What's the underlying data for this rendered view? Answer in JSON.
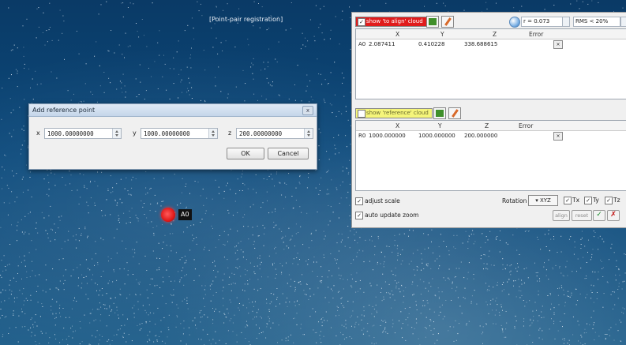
{
  "viewport": {
    "title": "[Point-pair registration]",
    "marker_label": "A0"
  },
  "dialog": {
    "title": "Add reference point",
    "close_icon": "close-icon",
    "x_label": "x",
    "x_value": "1000.00000000",
    "y_label": "y",
    "y_value": "1000.00000000",
    "z_label": "z",
    "z_value": "200.00000000",
    "ok_label": "OK",
    "cancel_label": "Cancel"
  },
  "panel": {
    "align_toggle_label": "show 'to align' cloud",
    "align_checked": true,
    "ref_toggle_label": "show 'reference' cloud",
    "ref_checked": false,
    "radius_value": "r = 0.073",
    "rms_value": "RMS < 20%",
    "columns": [
      "X",
      "Y",
      "Z",
      "Error"
    ],
    "align_points": [
      {
        "id": "A0",
        "x": "2.087411",
        "y": "0.410228",
        "z": "338.688615",
        "error": ""
      }
    ],
    "ref_points": [
      {
        "id": "R0",
        "x": "1000.000000",
        "y": "1000.000000",
        "z": "200.000000",
        "error": ""
      }
    ],
    "adjust_scale_label": "adjust scale",
    "adjust_scale_checked": true,
    "auto_update_zoom_label": "auto update zoom",
    "auto_update_zoom_checked": true,
    "rotation_label": "Rotation",
    "rotation_value": "XYZ",
    "tx_label": "Tx",
    "ty_label": "Ty",
    "tz_label": "Tz",
    "align_button_label": "align",
    "reset_button_label": "reset",
    "validate_icon": "check-icon",
    "cancel_icon": "close-icon"
  }
}
